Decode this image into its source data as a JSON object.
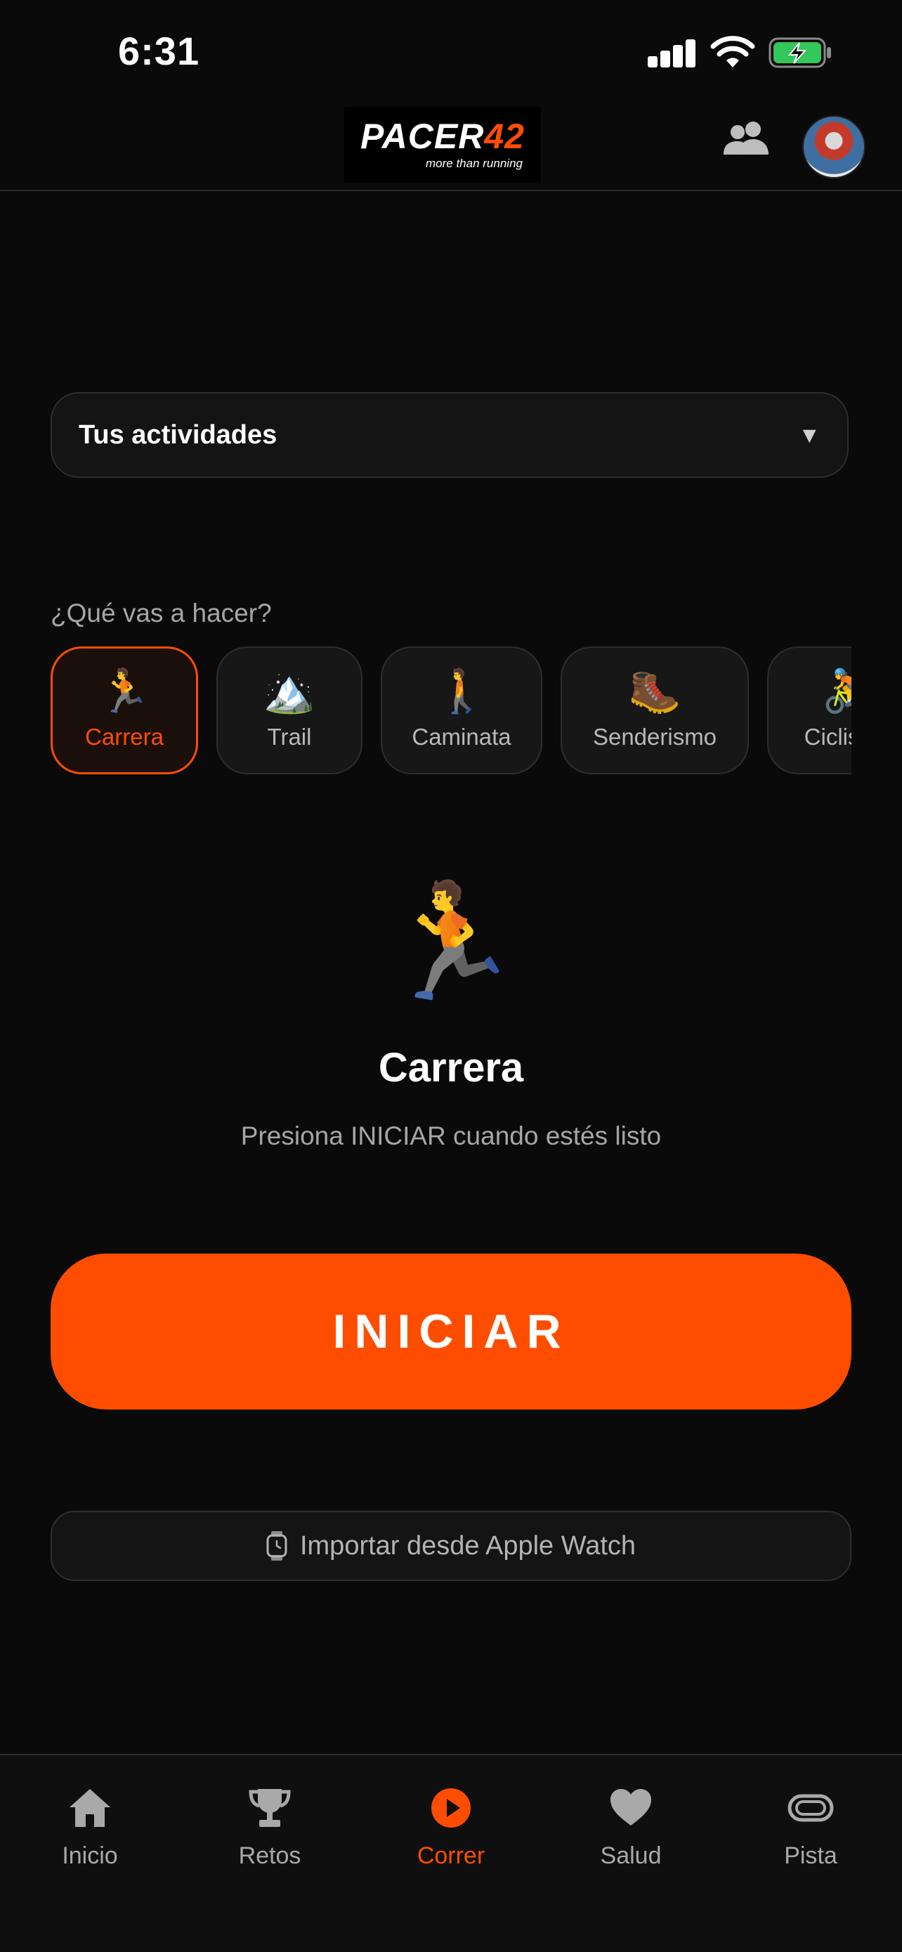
{
  "status_bar": {
    "time": "6:31"
  },
  "header": {
    "logo_main": "PACER",
    "logo_number": "42",
    "logo_tagline": "more than running"
  },
  "activities_dropdown": {
    "label": "Tus actividades",
    "arrow": "▼"
  },
  "activity_picker": {
    "question": "¿Qué vas a hacer?",
    "options": [
      {
        "emoji": "🏃",
        "label": "Carrera",
        "selected": true
      },
      {
        "emoji": "🏔️",
        "label": "Trail"
      },
      {
        "emoji": "🚶",
        "label": "Caminata"
      },
      {
        "emoji": "🥾",
        "label": "Senderismo"
      },
      {
        "emoji": "🚴",
        "label": "Ciclismo"
      }
    ]
  },
  "selected_activity": {
    "emoji": "🏃",
    "title": "Carrera",
    "hint": "Presiona INICIAR cuando estés listo"
  },
  "start_button": {
    "label": "INICIAR"
  },
  "import_button": {
    "label": "Importar desde Apple Watch",
    "icon": "watch-icon"
  },
  "tab_bar": {
    "tabs": [
      {
        "label": "Inicio",
        "icon": "home-icon"
      },
      {
        "label": "Retos",
        "icon": "trophy-icon"
      },
      {
        "label": "Correr",
        "icon": "play-circle-icon",
        "active": true
      },
      {
        "label": "Salud",
        "icon": "heart-icon"
      },
      {
        "label": "Pista",
        "icon": "track-icon"
      }
    ]
  },
  "colors": {
    "accent": "#ff4d00",
    "background": "#0a0a0a",
    "muted_text": "#a6a6a6"
  }
}
